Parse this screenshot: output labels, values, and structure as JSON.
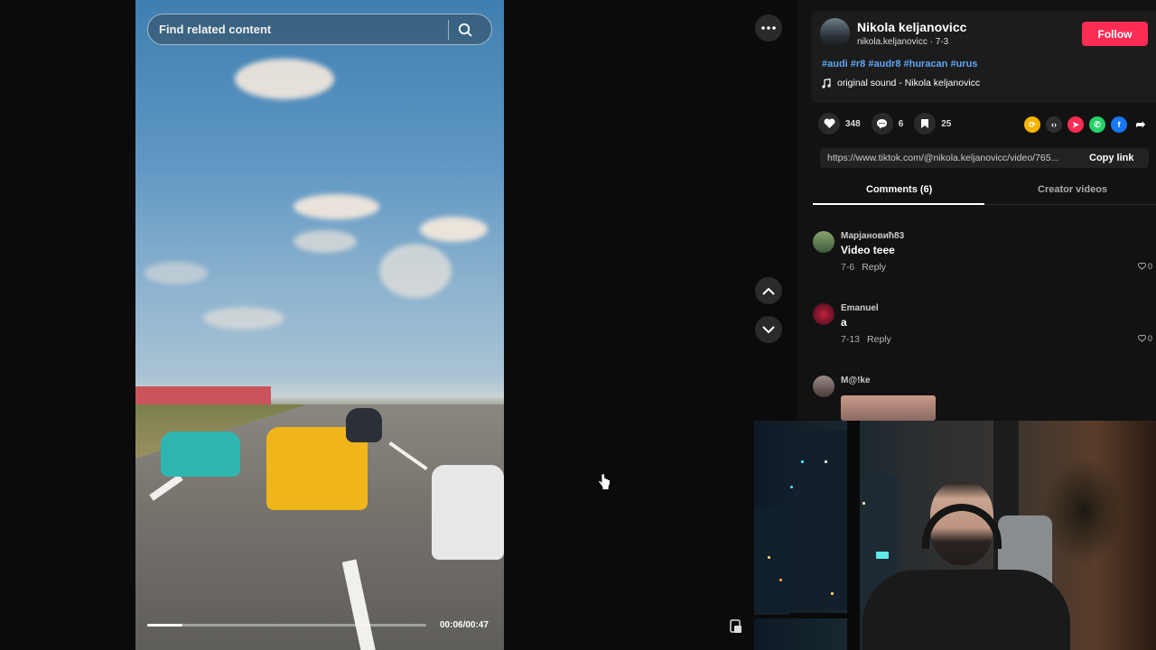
{
  "video": {
    "search_placeholder": "Find related content",
    "progress": 0.125,
    "time": "00:06/00:47"
  },
  "author": {
    "name": "Nikola keljanovicc",
    "handle_date": "nikola.keljanovicc · 7-3",
    "follow_label": "Follow"
  },
  "post": {
    "hashtags": "#audi #r8 #audr8 #huracan #urus",
    "sound": "original sound - Nikola keljanovicc"
  },
  "actions": {
    "likes": "348",
    "comments": "6",
    "saves": "25"
  },
  "share": {
    "link": "https://www.tiktok.com/@nikola.keljanovicc/video/765...",
    "copy_label": "Copy link",
    "icons": [
      "repost-icon",
      "embed-icon",
      "send-icon",
      "whatsapp-icon",
      "facebook-icon",
      "share-arrow-icon"
    ]
  },
  "tabs": {
    "comments": "Comments (6)",
    "creator_videos": "Creator videos"
  },
  "comments": [
    {
      "user": "Марјановић83",
      "text": "Video teee",
      "date": "7-6",
      "reply": "Reply",
      "likes": "0"
    },
    {
      "user": "Emanuel",
      "text": "a",
      "date": "7-13",
      "reply": "Reply",
      "likes": "0"
    },
    {
      "user": "M@!ke",
      "text": "",
      "date": "",
      "reply": "",
      "likes": ""
    }
  ],
  "colors": {
    "accent": "#fe2c55",
    "hashtag": "#5fa6f4",
    "background": "#0b0b0b"
  }
}
